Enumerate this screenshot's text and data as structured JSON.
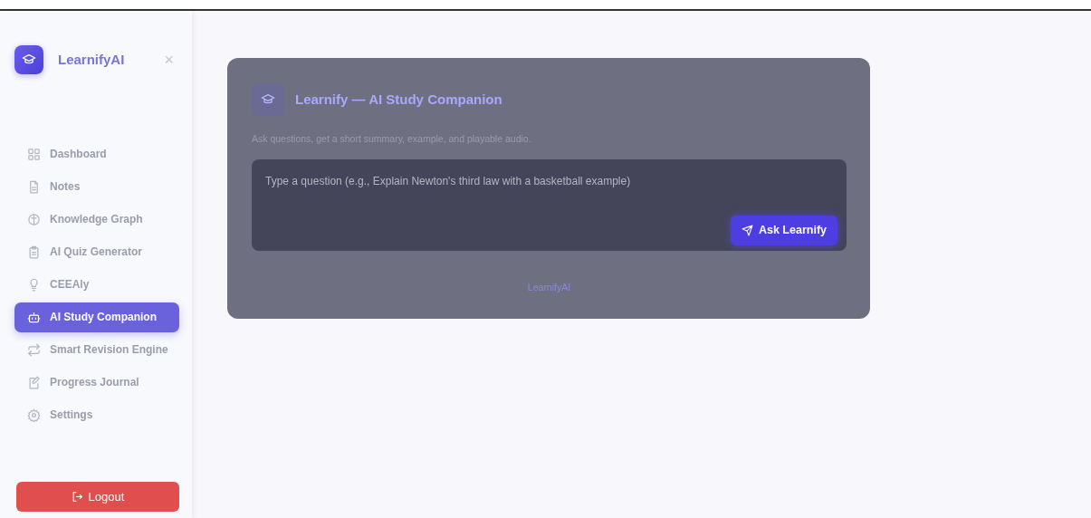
{
  "sidebar": {
    "brand": "LearnifyAI",
    "close": "×",
    "items": [
      {
        "label": "Dashboard",
        "selected": false
      },
      {
        "label": "Notes",
        "selected": false
      },
      {
        "label": "Knowledge Graph",
        "selected": false
      },
      {
        "label": "AI Quiz Generator",
        "selected": false
      },
      {
        "label": "CEEAly",
        "selected": false
      },
      {
        "label": "AI Study Companion",
        "selected": true
      },
      {
        "label": "Smart Revision Engine",
        "selected": false
      },
      {
        "label": "Progress Journal",
        "selected": false
      },
      {
        "label": "Settings",
        "selected": false
      }
    ],
    "logout": "Logout"
  },
  "card": {
    "title": "Learnify — AI Study Companion",
    "subtitle": "Ask questions, get a short summary, example, and playable audio.",
    "question": {
      "placeholder": "Type a question (e.g., Explain Newton's third law with a basketball example)"
    },
    "button": "Ask Learnify",
    "footer": "LearnifyAI"
  }
}
